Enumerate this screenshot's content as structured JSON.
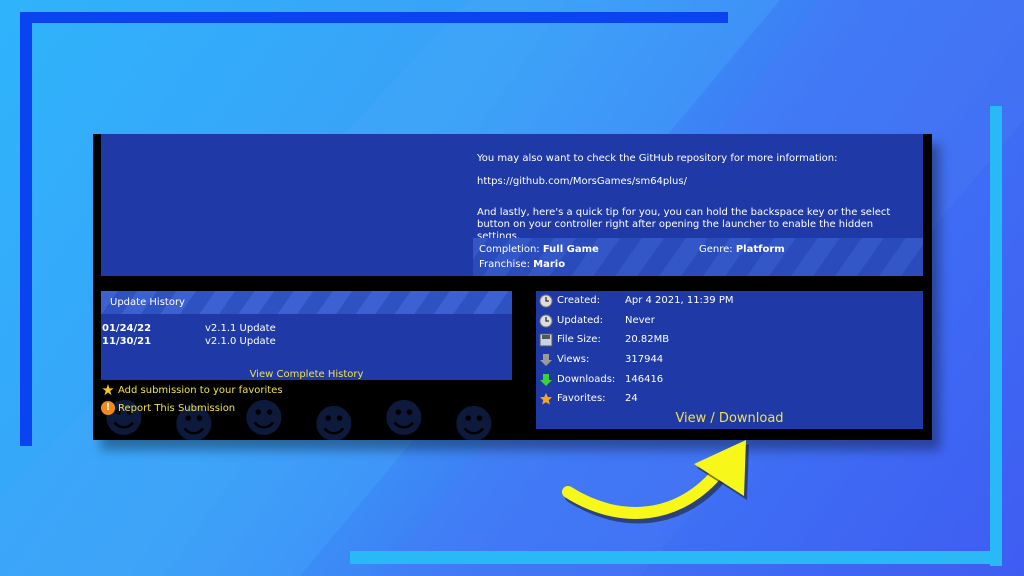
{
  "description": {
    "line1": "You may also want to check the GitHub repository for more information:",
    "line2": "https://github.com/MorsGames/sm64plus/",
    "line3": "And lastly, here's a quick tip for you, you can hold the backspace key or the select button on your controller right after opening the launcher to enable the hidden settings."
  },
  "meta": {
    "completion_label": "Completion:",
    "completion_value": "Full Game",
    "genre_label": "Genre:",
    "genre_value": "Platform",
    "franchise_label": "Franchise:",
    "franchise_value": "Mario"
  },
  "history": {
    "title": "Update History",
    "rows": [
      {
        "date": "01/24/22",
        "version": "v2.1.1 Update"
      },
      {
        "date": "11/30/21",
        "version": "v2.1.0 Update"
      }
    ],
    "view_all": "View Complete History"
  },
  "actions": {
    "favorite": "Add submission to your favorites",
    "report": "Report This Submission"
  },
  "stats": [
    {
      "label": "Created:",
      "value": "Apr 4 2021, 11:39 PM",
      "icon": "clock-icon"
    },
    {
      "label": "Updated:",
      "value": "Never",
      "icon": "clock-icon"
    },
    {
      "label": "File Size:",
      "value": "20.82MB",
      "icon": "disk-icon"
    },
    {
      "label": "Views:",
      "value": "317944",
      "icon": "eye-arrow-icon"
    },
    {
      "label": "Downloads:",
      "value": "146416",
      "icon": "download-arrow-icon"
    },
    {
      "label": "Favorites:",
      "value": "24",
      "icon": "star-icon"
    }
  ],
  "download_label": "View / Download",
  "colors": {
    "panel_blue": "#1f3aa7",
    "link_yellow": "#f1e14a",
    "arrow_yellow": "#f7f71a"
  }
}
